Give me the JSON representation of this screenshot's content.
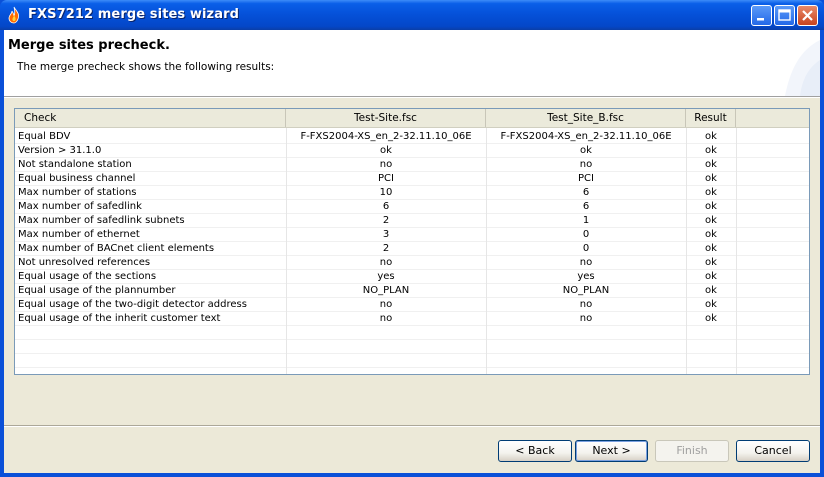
{
  "window": {
    "title": "FXS7212 merge sites wizard"
  },
  "header": {
    "title": "Merge sites precheck.",
    "description": "The merge precheck shows the following results:"
  },
  "table": {
    "columns": [
      "Check",
      "Test-Site.fsc",
      "Test_Site_B.fsc",
      "Result"
    ],
    "rows": [
      [
        "Equal BDV",
        "F-FXS2004-XS_en_2-32.11.10_06E",
        "F-FXS2004-XS_en_2-32.11.10_06E",
        "ok"
      ],
      [
        "Version > 31.1.0",
        "ok",
        "ok",
        "ok"
      ],
      [
        "Not standalone station",
        "no",
        "no",
        "ok"
      ],
      [
        "Equal business channel",
        "PCI",
        "PCI",
        "ok"
      ],
      [
        "Max number of stations",
        "10",
        "6",
        "ok"
      ],
      [
        "Max number of safedlink",
        "6",
        "6",
        "ok"
      ],
      [
        "Max number of safedlink subnets",
        "2",
        "1",
        "ok"
      ],
      [
        "Max number of ethernet",
        "3",
        "0",
        "ok"
      ],
      [
        "Max number of BACnet client elements",
        "2",
        "0",
        "ok"
      ],
      [
        "Not unresolved references",
        "no",
        "no",
        "ok"
      ],
      [
        "Equal usage of the sections",
        "yes",
        "yes",
        "ok"
      ],
      [
        "Equal usage of the plannumber",
        "NO_PLAN",
        "NO_PLAN",
        "ok"
      ],
      [
        "Equal usage of the two-digit detector address",
        "no",
        "no",
        "ok"
      ],
      [
        "Equal usage of the inherit customer text",
        "no",
        "no",
        "ok"
      ]
    ]
  },
  "buttons": {
    "back": "< Back",
    "next": "Next >",
    "finish": "Finish",
    "cancel": "Cancel"
  },
  "colors": {
    "titlebar": "#0550d8",
    "dialog_bg": "#ece9d8",
    "table_border": "#7a9ab8"
  }
}
